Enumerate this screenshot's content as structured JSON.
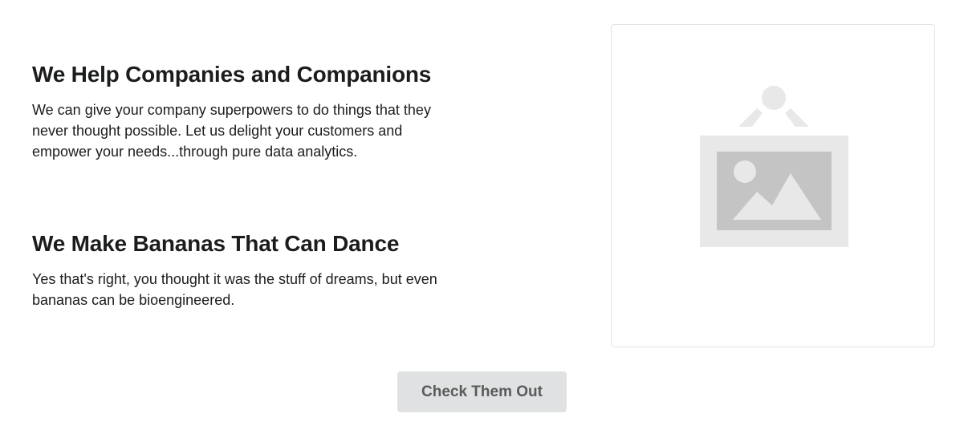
{
  "sections": [
    {
      "heading": "We Help Companies and Companions",
      "body": "We can give your company superpowers to do things that they never thought possible. Let us delight your customers and empower your needs...through pure data analytics."
    },
    {
      "heading": "We Make Bananas That Can Dance",
      "body": "Yes that's right, you thought it was the stuff of dreams, but even bananas can be bioengineered."
    }
  ],
  "image": {
    "icon": "image-placeholder-icon"
  },
  "cta": {
    "label": "Check Them Out"
  },
  "colors": {
    "heading": "#1b1c1d",
    "button_bg": "#e0e1e2",
    "button_text": "#5a5a5a",
    "placeholder_light": "#e8e8e9",
    "placeholder_dark": "#c4c4c5"
  }
}
